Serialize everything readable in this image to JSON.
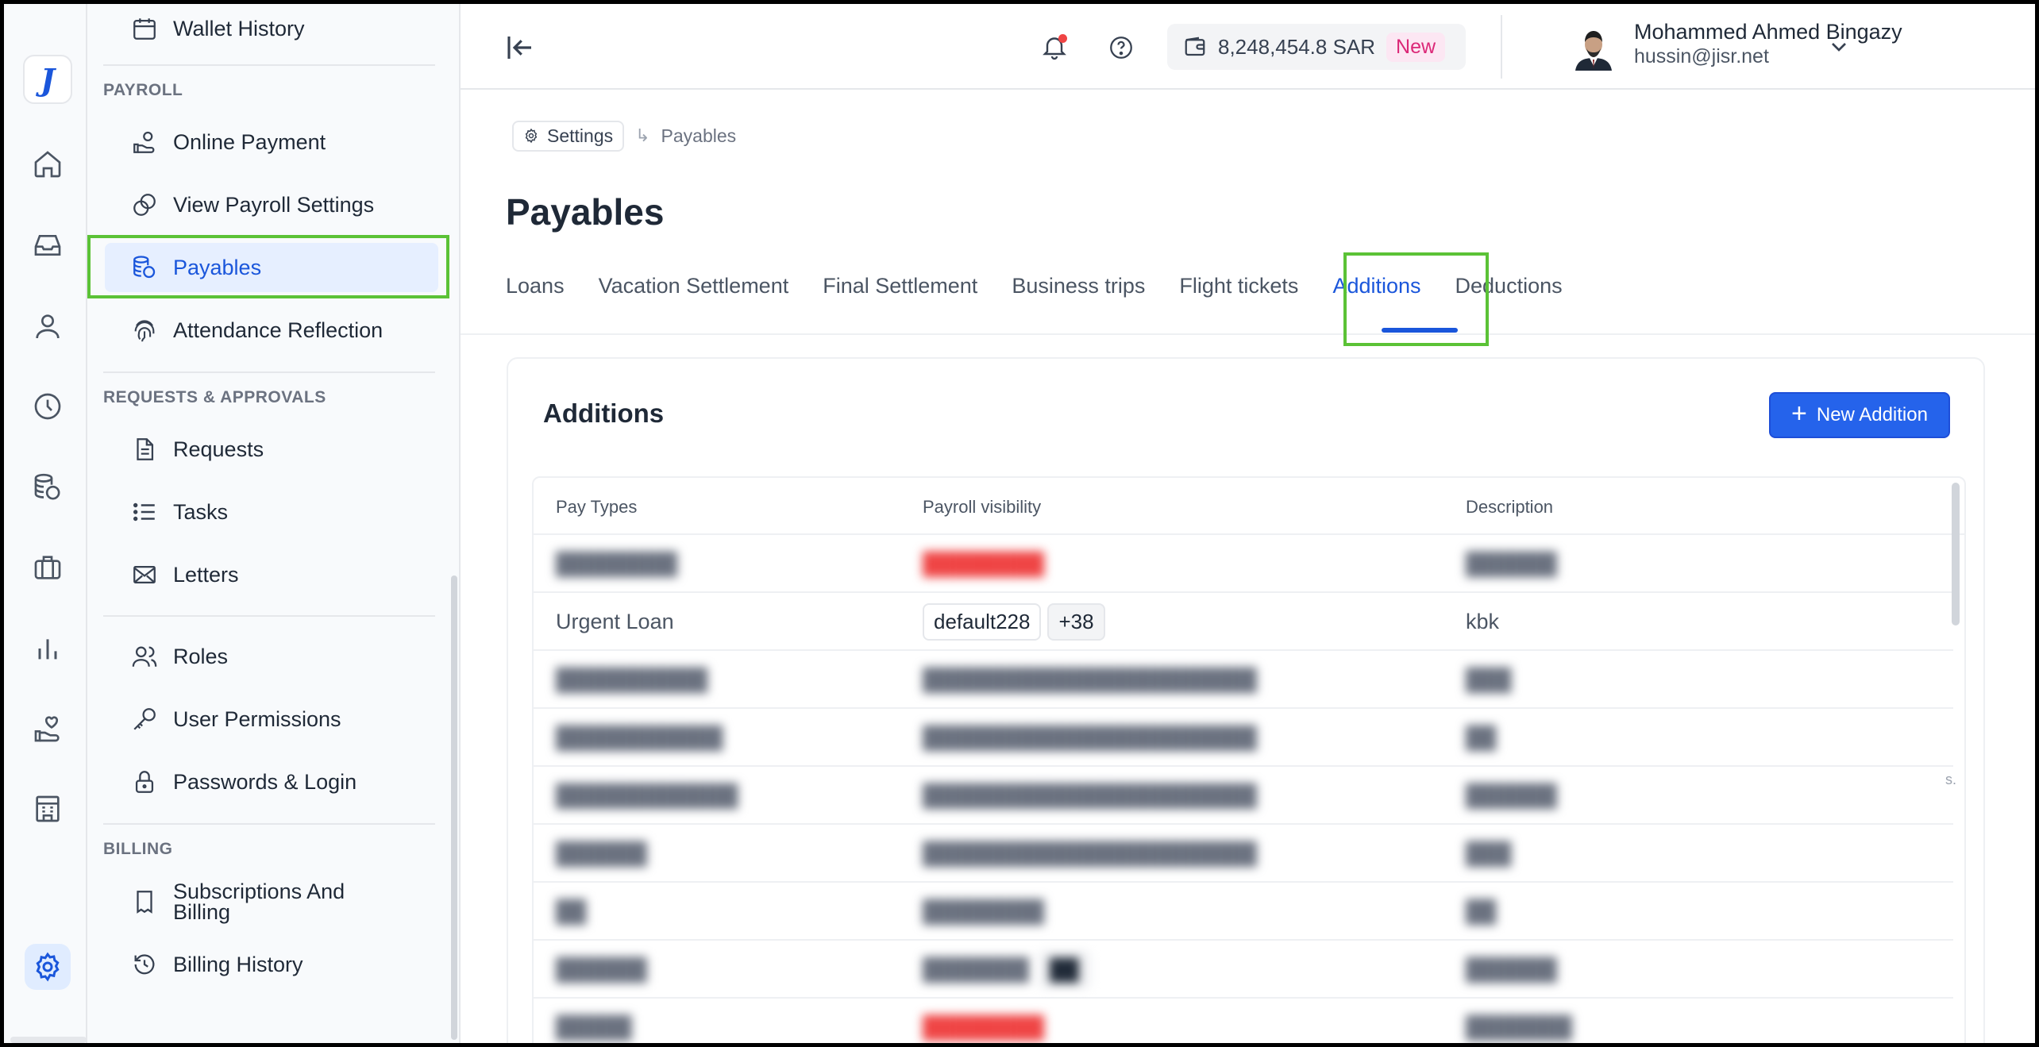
{
  "rail": {
    "logo": "J",
    "icons": [
      "home-icon",
      "inbox-icon",
      "user-icon",
      "clock-icon",
      "coins-icon",
      "briefcase-icon",
      "chart-icon",
      "hand-heart-icon",
      "building-icon",
      "gear-icon"
    ]
  },
  "sidebar": {
    "top_item": "Wallet History",
    "sections": {
      "payroll": "PAYROLL",
      "requests": "REQUESTS & APPROVALS",
      "billing": "BILLING"
    },
    "payroll_items": [
      "Online Payment",
      "View Payroll Settings",
      "Payables",
      "Attendance Reflection"
    ],
    "requests_items": [
      "Requests",
      "Tasks",
      "Letters"
    ],
    "access_items": [
      "Roles",
      "User Permissions",
      "Passwords & Login"
    ],
    "billing_items": [
      "Subscriptions And Billing",
      "Billing History"
    ],
    "active": "Payables"
  },
  "topbar": {
    "wallet_amount": "8,248,454.8 SAR",
    "wallet_badge": "New",
    "user_name": "Mohammed Ahmed Bingazy",
    "user_email": "hussin@jisr.net"
  },
  "breadcrumb": {
    "parent": "Settings",
    "current": "Payables"
  },
  "page": {
    "title": "Payables",
    "tabs": [
      "Loans",
      "Vacation Settlement",
      "Final Settlement",
      "Business trips",
      "Flight tickets",
      "Additions",
      "Deductions"
    ],
    "active_tab": "Additions"
  },
  "card": {
    "title": "Additions",
    "new_button": "New Addition",
    "columns": [
      "Pay Types",
      "Payroll visibility",
      "Description"
    ],
    "visible_row": {
      "pay_type": "Urgent Loan",
      "chips": [
        "default228",
        "+38"
      ],
      "description": "kbk"
    },
    "faint_text": "s."
  },
  "colors": {
    "accent": "#1a56db",
    "highlight": "#5bc236",
    "badge": "#db2777"
  }
}
